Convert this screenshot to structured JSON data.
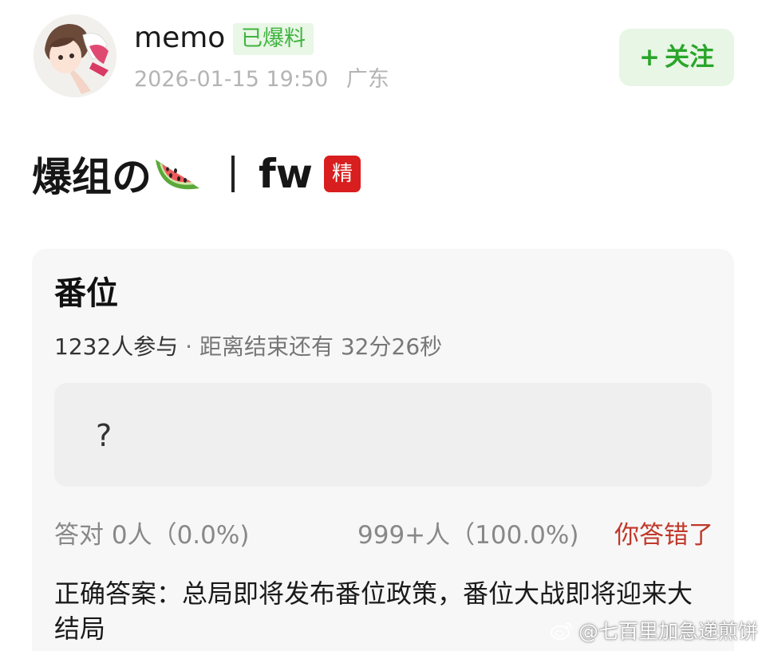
{
  "header": {
    "username": "memo",
    "tag": "已爆料",
    "date": "2026-01-15 19:50",
    "location": "广东",
    "follow_plus": "+",
    "follow_label": "关注",
    "avatar_icon": "anime-avatar-icon"
  },
  "post": {
    "title_prefix": "爆组の",
    "title_suffix": "fw",
    "badge": "精",
    "title_icon": "watermelon-icon"
  },
  "quiz": {
    "title": "番位",
    "participants": "1232人参与",
    "separator": " · ",
    "countdown": "距离结束还有 32分26秒",
    "option_text": "?",
    "correct_stats": "答对  0人（0.0%)",
    "wrong_stats": "999+人（100.0%)",
    "result": "你答错了",
    "answer": "正确答案：总局即将发布番位政策，番位大战即将迎来大结局"
  },
  "watermark": {
    "text": "@七百里加急递煎饼",
    "icon": "weibo-icon"
  },
  "colors": {
    "accent_green": "#2aa52a",
    "badge_red": "#d81e1e",
    "wrong_red": "#c0392b",
    "card_bg": "#f7f7f7"
  }
}
